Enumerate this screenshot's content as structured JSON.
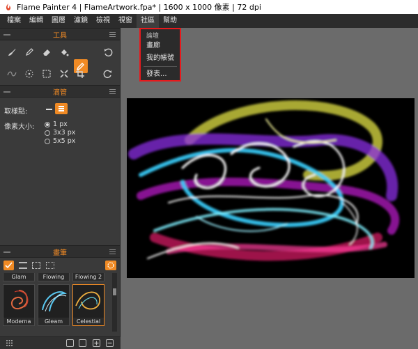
{
  "window": {
    "title": "Flame Painter 4 | FlameArtwork.fpa* | 1600 x 1000 像素 | 72 dpi"
  },
  "menu": {
    "items": [
      "檔案",
      "編輯",
      "圖層",
      "濾鏡",
      "檢視",
      "視窗",
      "社區",
      "幫助"
    ],
    "active_index": 6
  },
  "community_menu": {
    "items": [
      "論壇",
      "畫廊",
      "我的帳號",
      "發表..."
    ]
  },
  "panels": {
    "tools": {
      "title": "工具"
    },
    "dropper": {
      "title": "滴管",
      "sample_label": "取樣點:",
      "pixel_size_label": "像素大小:",
      "options": [
        "1 px",
        "3x3 px",
        "5x5 px"
      ],
      "selected": "1 px"
    },
    "brushes": {
      "title": "畫筆",
      "row1": [
        "Winter Glam",
        "Flowing",
        "Flowing 2"
      ],
      "row2": [
        "Moderna",
        "Gleam",
        "Celestial"
      ],
      "selected": "Celestial"
    }
  },
  "colors": {
    "accent": "#f08a24",
    "highlight_border": "#e8191c",
    "panel_bg": "#3a3a3a",
    "workspace_bg": "#6b6b6b"
  }
}
